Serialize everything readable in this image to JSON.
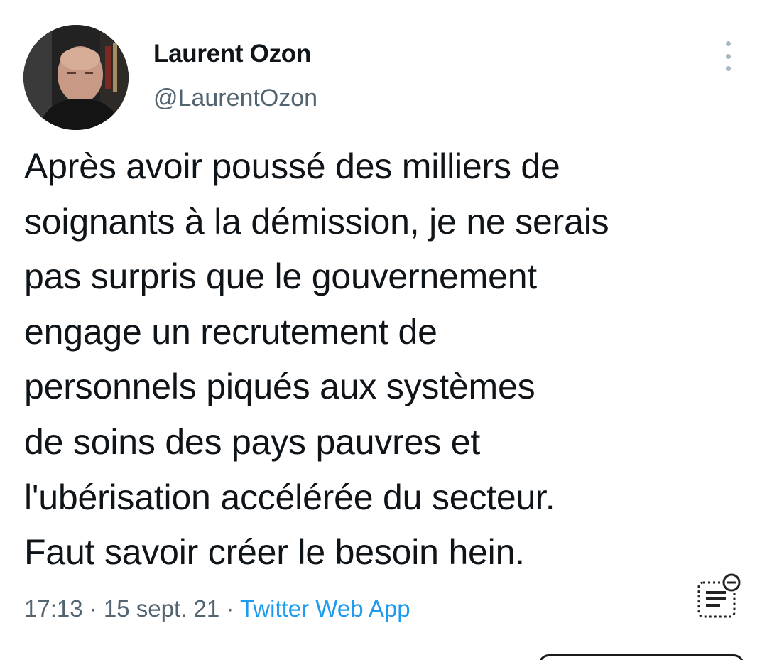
{
  "author": {
    "display_name": "Laurent Ozon",
    "handle": "@LaurentOzon",
    "avatar_icon": "profile-photo"
  },
  "tweet": {
    "lines": [
      "Après avoir poussé des milliers de",
      "soignants à la démission, je ne serais",
      "pas surpris que le gouvernement",
      "engage un recrutement de",
      "personnels piqués aux systèmes",
      "de soins des pays pauvres et",
      "l'ubérisation accélérée du secteur.",
      "Faut savoir créer le besoin hein."
    ]
  },
  "meta": {
    "time": "17:13",
    "separator": " · ",
    "date": "15 sept. 21",
    "source": "Twitter Web App"
  },
  "icons": {
    "more": "more-vertical-icon",
    "reader": "reader-mode-icon"
  },
  "colors": {
    "text": "#0f1419",
    "secondary": "#536471",
    "link": "#1d9bf0",
    "divider": "#dde3e8"
  }
}
